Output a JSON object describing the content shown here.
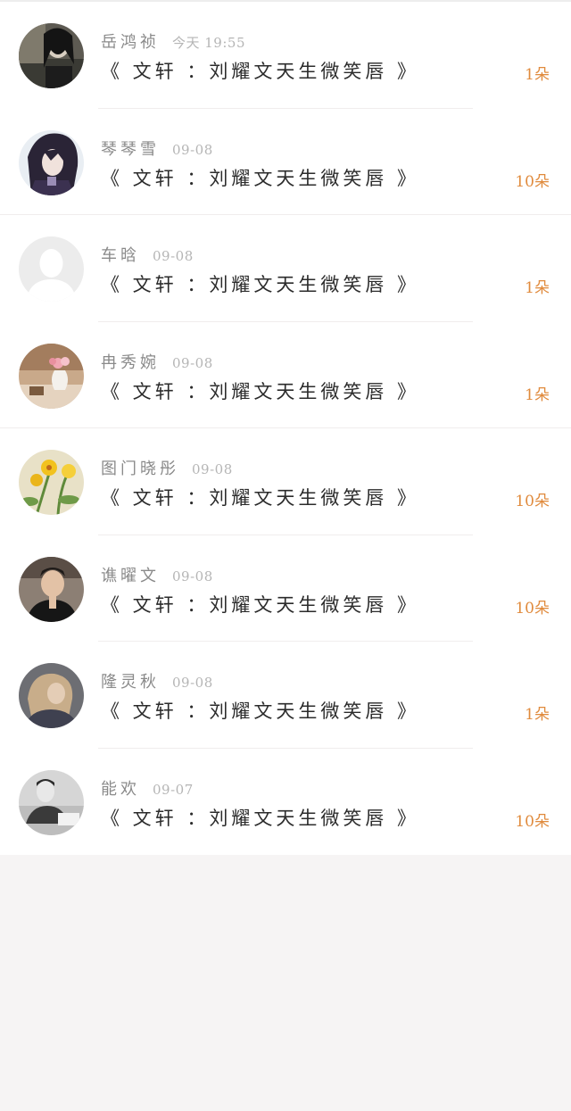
{
  "records": [
    {
      "name": "岳鸿祯",
      "time": "今天 19:55",
      "title": "《 文轩 ：刘耀文天生微笑唇 》",
      "count": "1朵",
      "avatar_icon": "avatar-dark-portrait"
    },
    {
      "name": "琴琴雪",
      "time": "09-08",
      "title": "《 文轩 ：刘耀文天生微笑唇 》",
      "count": "10朵",
      "avatar_icon": "avatar-anime-character"
    },
    {
      "name": "车晗",
      "time": "09-08",
      "title": "《 文轩 ：刘耀文天生微笑唇 》",
      "count": "1朵",
      "avatar_icon": "avatar-default-placeholder"
    },
    {
      "name": "冉秀婉",
      "time": "09-08",
      "title": "《 文轩 ：刘耀文天生微笑唇 》",
      "count": "1朵",
      "avatar_icon": "avatar-flower-vase"
    },
    {
      "name": "图门晓彤",
      "time": "09-08",
      "title": "《 文轩 ：刘耀文天生微笑唇 》",
      "count": "10朵",
      "avatar_icon": "avatar-yellow-flowers"
    },
    {
      "name": "谯曜文",
      "time": "09-08",
      "title": "《 文轩 ：刘耀文天生微笑唇 》",
      "count": "10朵",
      "avatar_icon": "avatar-person-photo"
    },
    {
      "name": "隆灵秋",
      "time": "09-08",
      "title": "《 文轩 ：刘耀文天生微笑唇 》",
      "count": "1朵",
      "avatar_icon": "avatar-blonde-person"
    },
    {
      "name": "能欢",
      "time": "09-07",
      "title": "《 文轩 ：刘耀文天生微笑唇 》",
      "count": "10朵",
      "avatar_icon": "avatar-grayscale-photo"
    }
  ],
  "colors": {
    "count": "#e08a3c",
    "name": "#8a8a8a",
    "time": "#b5b5b5",
    "title": "#2b2b2b",
    "page_background": "#f6f4f4"
  }
}
